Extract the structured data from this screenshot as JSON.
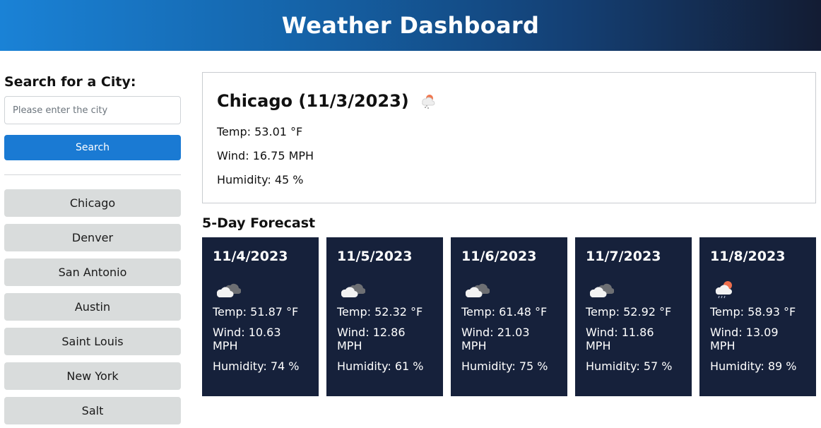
{
  "header": {
    "title": "Weather Dashboard"
  },
  "sidebar": {
    "title": "Search for a City:",
    "input_placeholder": "Please enter the city",
    "input_value": "",
    "search_label": "Search",
    "history": [
      "Chicago",
      "Denver",
      "San Antonio",
      "Austin",
      "Saint Louis",
      "New York",
      "Salt"
    ]
  },
  "current": {
    "title": "Chicago (11/3/2023)",
    "icon": "light-snow-icon",
    "temp": "Temp: 53.01 °F",
    "wind": "Wind: 16.75 MPH",
    "humidity": "Humidity: 45 %"
  },
  "forecast": {
    "title": "5-Day Forecast",
    "days": [
      {
        "date": "11/4/2023",
        "icon": "cloudy-icon",
        "temp": "Temp: 51.87 °F",
        "wind": "Wind: 10.63 MPH",
        "humidity": "Humidity: 74 %"
      },
      {
        "date": "11/5/2023",
        "icon": "cloudy-icon",
        "temp": "Temp: 52.32 °F",
        "wind": "Wind: 12.86 MPH",
        "humidity": "Humidity: 61 %"
      },
      {
        "date": "11/6/2023",
        "icon": "cloudy-icon",
        "temp": "Temp: 61.48 °F",
        "wind": "Wind: 21.03 MPH",
        "humidity": "Humidity: 75 %"
      },
      {
        "date": "11/7/2023",
        "icon": "cloudy-icon",
        "temp": "Temp: 52.92 °F",
        "wind": "Wind: 11.86 MPH",
        "humidity": "Humidity: 57 %"
      },
      {
        "date": "11/8/2023",
        "icon": "rain-sun-icon",
        "temp": "Temp: 58.93 °F",
        "wind": "Wind: 13.09 MPH",
        "humidity": "Humidity: 89 %"
      }
    ]
  },
  "colors": {
    "header_start": "#1a82d6",
    "header_end": "#131c33",
    "search_button": "#1a7ad3",
    "history_item": "#d9dcdc",
    "forecast_card": "#16213b"
  }
}
